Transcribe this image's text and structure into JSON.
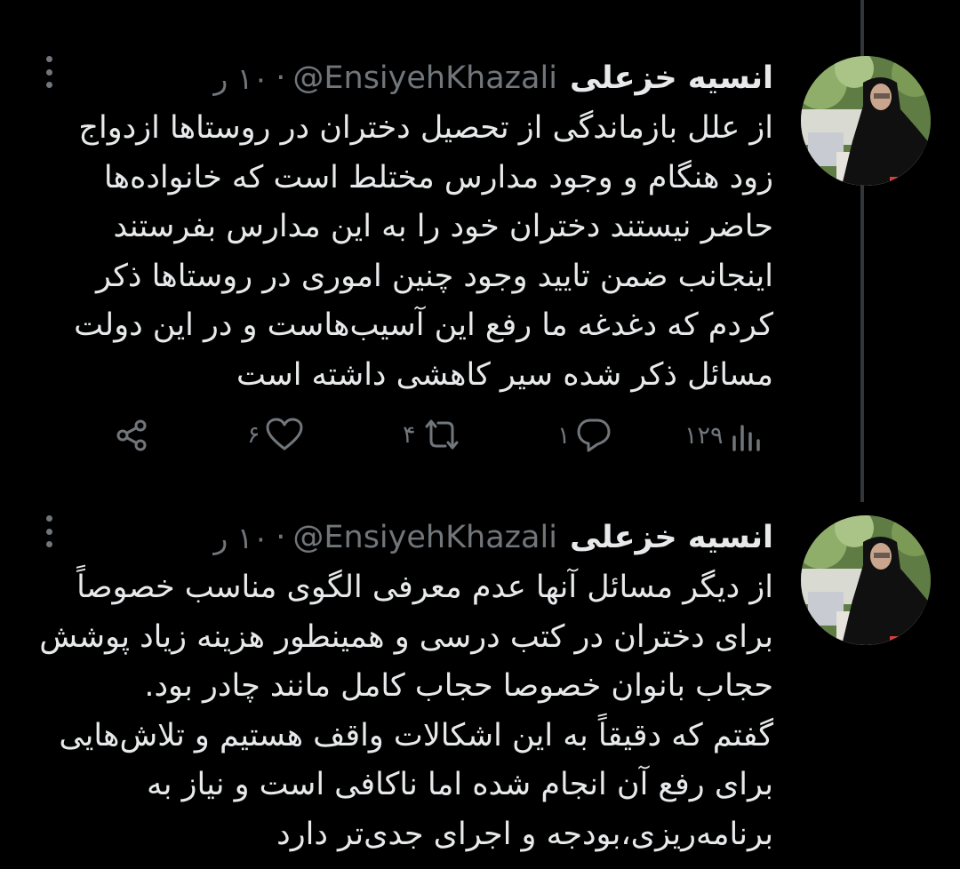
{
  "colors": {
    "background": "#000000",
    "text": "#e7e9ea",
    "muted": "#71767b",
    "thread_line": "#333639"
  },
  "tweets": [
    {
      "author_name": "انسیه خزعلی",
      "handle": "@EnsiyehKhazali",
      "separator": "·",
      "time": "۱۰ ر",
      "text_lines": [
        "از علل بازماندگی از تحصیل دختران در روستاها ازدواج",
        "زود هنگام و وجود مدارس مختلط است که خانواده‌ها",
        "حاضر نیستند دختران خود را به این مدارس بفرستند",
        "اینجانب ضمن تایید وجود چنین اموری در روستاها ذکر",
        "کردم که دغدغه ما رفع این آسیب‌هاست و در این دولت",
        "مسائل ذکر شده سیر کاهشی داشته است"
      ],
      "views": "۱۲۹",
      "replies": "۱",
      "retweets": "۴",
      "likes": "۶",
      "icons": {
        "more": "more-icon",
        "views": "views-icon",
        "reply": "reply-icon",
        "retweet": "retweet-icon",
        "like": "like-icon",
        "share": "share-icon"
      }
    },
    {
      "author_name": "انسیه خزعلی",
      "handle": "@EnsiyehKhazali",
      "separator": "·",
      "time": "۱۰ ر",
      "text_lines": [
        "از دیگر مسائل آنها عدم معرفی الگوی مناسب خصوصاً",
        "برای دختران در کتب درسی و همینطور هزینه زیاد پوشش",
        "حجاب بانوان خصوصا حجاب کامل مانند چادر بود.",
        "گفتم که دقیقاً به  این اشکالات واقف هستیم و تلاش‌هایی",
        "برای رفع آن انجام شده اما ناکافی است و نیاز به",
        "برنامه‌ریزی،بودجه و اجرای جدی‌تر دارد"
      ]
    }
  ]
}
